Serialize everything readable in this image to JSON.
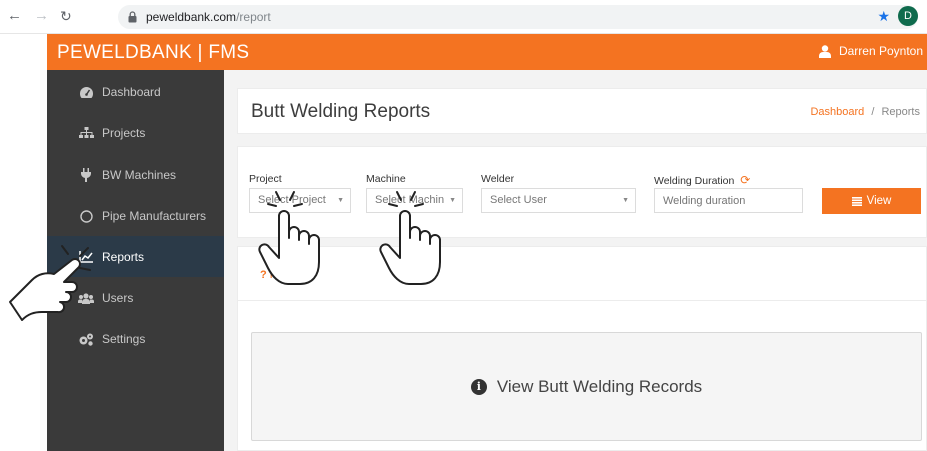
{
  "browser": {
    "url_host": "peweldbank.com",
    "url_path": "/report",
    "profile_initial": "D"
  },
  "header": {
    "brand": "PEWELDBANK | FMS",
    "user_name": "Darren Poynton"
  },
  "sidebar": {
    "items": [
      {
        "label": "Dashboard",
        "icon": "dashboard-icon"
      },
      {
        "label": "Projects",
        "icon": "sitemap-icon"
      },
      {
        "label": "BW Machines",
        "icon": "plug-icon"
      },
      {
        "label": "Pipe Manufacturers",
        "icon": "circle-icon"
      },
      {
        "label": "Reports",
        "icon": "line-chart-icon",
        "active": true
      },
      {
        "label": "Users",
        "icon": "users-icon"
      },
      {
        "label": "Settings",
        "icon": "cogs-icon"
      }
    ]
  },
  "page": {
    "title": "Butt Welding Reports",
    "breadcrumb_home": "Dashboard",
    "breadcrumb_sep": "/",
    "breadcrumb_current": "Reports"
  },
  "filters": {
    "project_label": "Project",
    "project_value": "Select Project",
    "machine_label": "Machine",
    "machine_value": "Select Machin",
    "welder_label": "Welder",
    "welder_value": "Select User",
    "duration_label": "Welding Duration",
    "duration_placeholder": "Welding duration",
    "view_button": "View"
  },
  "help": {
    "label": "Help"
  },
  "records": {
    "message": "View Butt Welding Records"
  },
  "colors": {
    "accent": "#f47321",
    "sidebar": "#3a3a3a",
    "sidebar_active": "#2b3a48"
  }
}
